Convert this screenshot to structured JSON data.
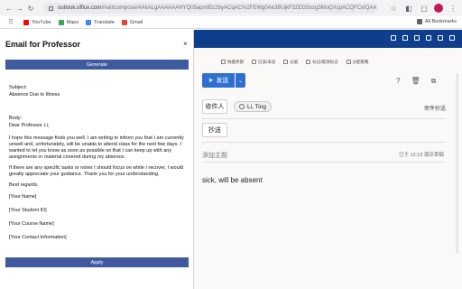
{
  "browser": {
    "url_host": "outlook.office.com",
    "url_path": "/mail/compose/AAkALgAAAAAAHYQ05apmIEc2byACqAC%2FEWg0Ae3BUjkF3ZEG5ozg3MuQXcpACQFCxIQAA",
    "bookmarks": [
      {
        "label": "YouTube",
        "color": "#ff0000"
      },
      {
        "label": "Maps",
        "color": "#34a853"
      },
      {
        "label": "Translate",
        "color": "#4285f4"
      },
      {
        "label": "Gmail",
        "color": "#ea4335"
      }
    ],
    "all_bookmarks": "All Bookmarks"
  },
  "panel": {
    "title": "Email for Professor",
    "close": "×",
    "generate_label": "Generate",
    "subject_label": "Subject:",
    "subject_value": "Absence Due to Illness",
    "body_label": "Body:",
    "greeting": "Dear Professor Li,",
    "paragraph1": "I hope this message finds you well. I am writing to inform you that I am currently unwell and, unfortunately, will be unable to attend class for the next few days. I wanted to let you know as soon as possible so that I can keep up with any assignments or material covered during my absence.",
    "paragraph2": "If there are any specific tasks or notes I should focus on while I recover, I would greatly appreciate your guidance. Thank you for your understanding.",
    "closing": "Best regards,",
    "name": "[Your Name]",
    "student_id": "[Your Student ID]",
    "course": "[Your Course Name]",
    "contact": "[Your Contact Information]",
    "apply_label": "Apply"
  },
  "outlook": {
    "accent": "#0f3f8c",
    "ribbon": [
      "快捷步骤",
      "已读/未读",
      "分类",
      "标记/取消标记",
      "分配策略"
    ],
    "send_label": "发送",
    "to_label": "收件人",
    "cc_label": "抄送",
    "recipient": "Li, Ting",
    "bcc_label": "密件抄送",
    "subject_placeholder": "添加主题",
    "draft_status": "已于 12:13 保存草稿",
    "body": "sick, will be absent"
  }
}
